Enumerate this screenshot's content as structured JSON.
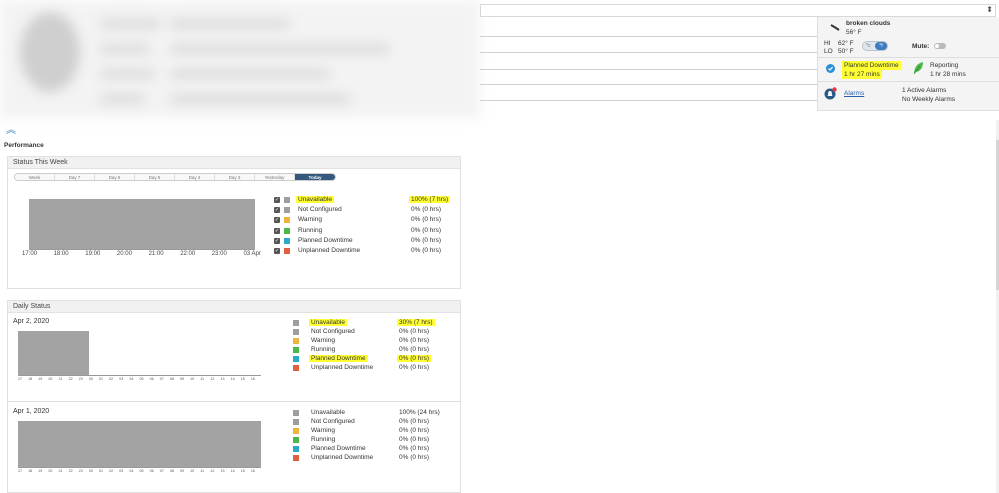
{
  "header": {
    "dropdown_arrow": "⬍"
  },
  "weather": {
    "condition": "broken clouds",
    "current_temp": "56° F",
    "hi_label": "HI",
    "hi_value": "62° F",
    "lo_label": "LO",
    "lo_value": "50° F",
    "unit_c": "°c",
    "unit_f": "°f",
    "mute_label": "Mute:",
    "planned_downtime_label": "Planned Downtime",
    "planned_downtime_value": "1 hr 27 mins",
    "reporting_label": "Reporting",
    "reporting_value": "1 hr 28 mins",
    "alarms_link": "Alarms",
    "active_alarms": "1 Active Alarms",
    "weekly_alarms": "No Weekly Alarms"
  },
  "performance": {
    "collapse_icon": "︽",
    "title": "Performance",
    "status_week": {
      "title": "Status This Week",
      "tabs": [
        "Week",
        "Day 7",
        "Day 6",
        "Day 5",
        "Day 4",
        "Day 3",
        "Yesterday",
        "Today"
      ],
      "active_tab": "Today",
      "x_ticks": [
        "17:00",
        "18:00",
        "19:00",
        "20:00",
        "21:00",
        "22:00",
        "23:00",
        "03 Apr"
      ],
      "legend": [
        {
          "label": "Unavailable",
          "value": "100% (7 hrs)",
          "color": "#9e9e9e",
          "highlight": true
        },
        {
          "label": "Not Configured",
          "value": "0% (0 hrs)",
          "color": "#9e9e9e",
          "highlight": false
        },
        {
          "label": "Warning",
          "value": "0% (0 hrs)",
          "color": "#f0b43c",
          "highlight": false
        },
        {
          "label": "Running",
          "value": "0% (0 hrs)",
          "color": "#4cb84c",
          "highlight": false
        },
        {
          "label": "Planned Downtime",
          "value": "0% (0 hrs)",
          "color": "#2aa9c9",
          "highlight": false
        },
        {
          "label": "Unplanned Downtime",
          "value": "0% (0 hrs)",
          "color": "#e06040",
          "highlight": false
        }
      ]
    },
    "daily_status": {
      "title": "Daily Status",
      "days": [
        {
          "date": "Apr 2, 2020",
          "unavailable_fraction": 0.29,
          "legend": [
            {
              "label": "Unavailable",
              "value": "30% (7 hrs)",
              "color": "#9e9e9e",
              "highlight": true
            },
            {
              "label": "Not Configured",
              "value": "0% (0 hrs)",
              "color": "#9e9e9e",
              "highlight": false
            },
            {
              "label": "Warning",
              "value": "0% (0 hrs)",
              "color": "#f0b43c",
              "highlight": false
            },
            {
              "label": "Running",
              "value": "0% (0 hrs)",
              "color": "#4cb84c",
              "highlight": false
            },
            {
              "label": "Planned Downtime",
              "value": "0% (0 hrs)",
              "color": "#2aa9c9",
              "highlight": true
            },
            {
              "label": "Unplanned Downtime",
              "value": "0% (0 hrs)",
              "color": "#e06040",
              "highlight": false
            }
          ]
        },
        {
          "date": "Apr 1, 2020",
          "unavailable_fraction": 1.0,
          "legend": [
            {
              "label": "Unavailable",
              "value": "100% (24 hrs)",
              "color": "#9e9e9e",
              "highlight": false
            },
            {
              "label": "Not Configured",
              "value": "0% (0 hrs)",
              "color": "#9e9e9e",
              "highlight": false
            },
            {
              "label": "Warning",
              "value": "0% (0 hrs)",
              "color": "#f0b43c",
              "highlight": false
            },
            {
              "label": "Running",
              "value": "0% (0 hrs)",
              "color": "#4cb84c",
              "highlight": false
            },
            {
              "label": "Planned Downtime",
              "value": "0% (0 hrs)",
              "color": "#2aa9c9",
              "highlight": false
            },
            {
              "label": "Unplanned Downtime",
              "value": "0% (0 hrs)",
              "color": "#e06040",
              "highlight": false
            }
          ]
        }
      ],
      "hour_ticks": [
        "17",
        "18",
        "19",
        "20",
        "21",
        "22",
        "23",
        "00",
        "01",
        "02",
        "03",
        "04",
        "05",
        "06",
        "07",
        "08",
        "09",
        "10",
        "11",
        "12",
        "13",
        "14",
        "15",
        "16"
      ]
    }
  }
}
